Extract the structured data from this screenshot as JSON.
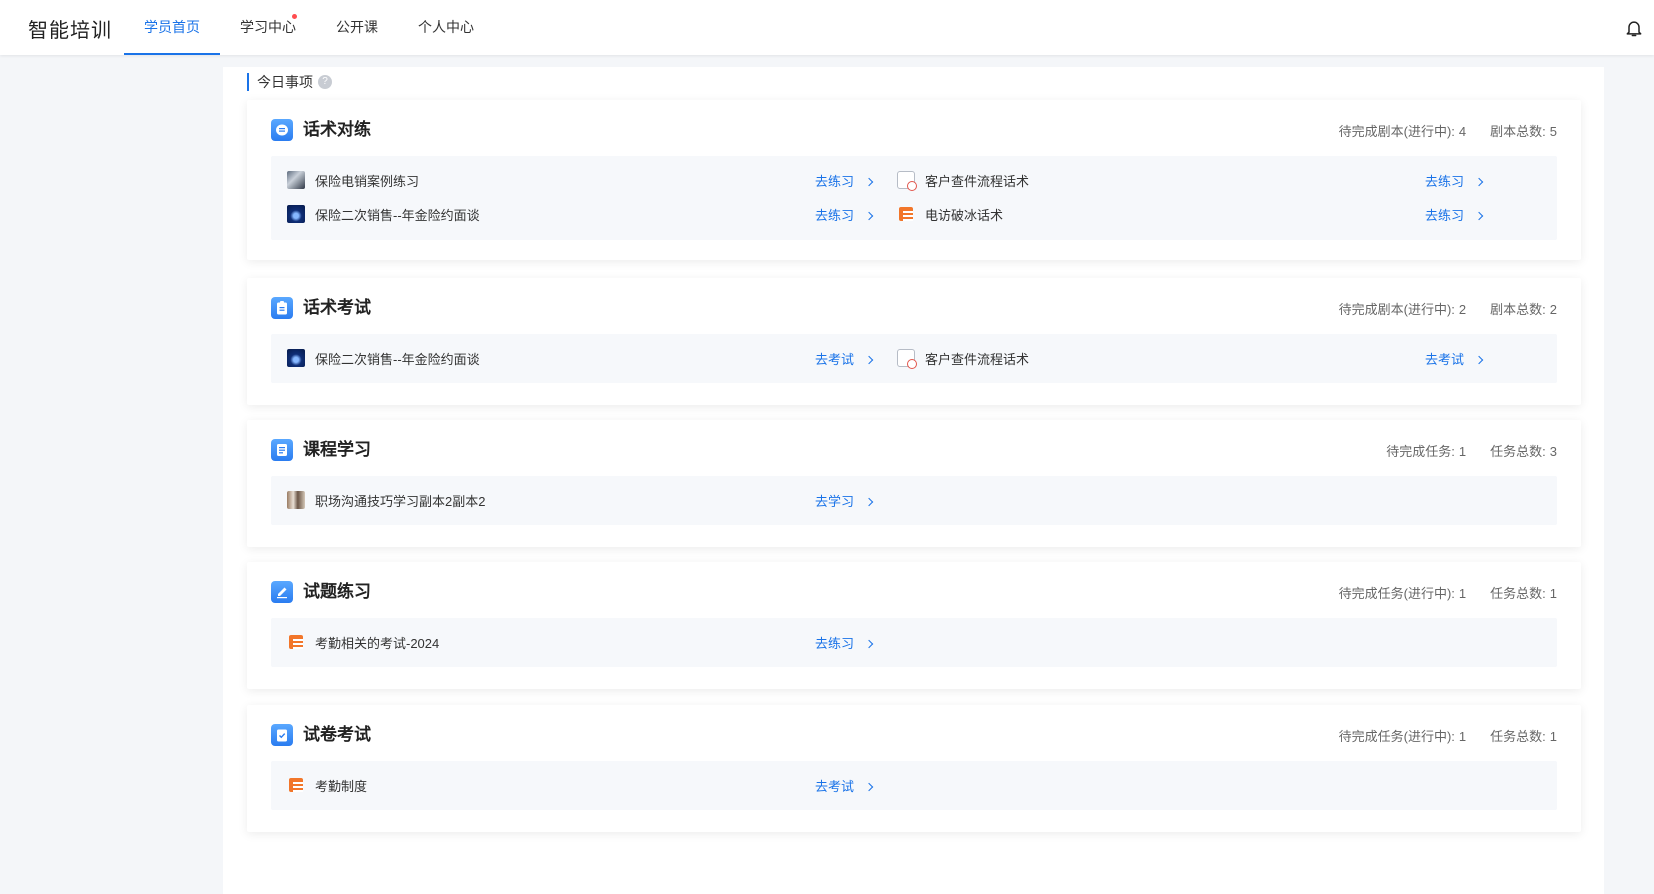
{
  "app": {
    "title": "智能培训"
  },
  "nav": {
    "tabs": [
      {
        "label": "学员首页",
        "active": true
      },
      {
        "label": "学习中心",
        "badge_dot": true
      },
      {
        "label": "公开课"
      },
      {
        "label": "个人中心"
      }
    ]
  },
  "today": {
    "title": "今日事项",
    "help_glyph": "?"
  },
  "sections": [
    {
      "title": "话术对练",
      "stats": [
        {
          "label": "待完成剧本(进行中):",
          "value": "4"
        },
        {
          "label": "剧本总数:",
          "value": "5"
        }
      ],
      "items": [
        {
          "name": "保险电销案例练习",
          "action": "去练习",
          "thumb": "photo"
        },
        {
          "name": "客户查件流程话术",
          "action": "去练习",
          "thumb": "calendar"
        },
        {
          "name": "保险二次销售--年金险约面谈",
          "action": "去练习",
          "thumb": "night"
        },
        {
          "name": "电访破冰话术",
          "action": "去练习",
          "thumb": "list"
        }
      ]
    },
    {
      "title": "话术考试",
      "stats": [
        {
          "label": "待完成剧本(进行中):",
          "value": "2"
        },
        {
          "label": "剧本总数:",
          "value": "2"
        }
      ],
      "items": [
        {
          "name": "保险二次销售--年金险约面谈",
          "action": "去考试",
          "thumb": "night"
        },
        {
          "name": "客户查件流程话术",
          "action": "去考试",
          "thumb": "calendar"
        }
      ]
    },
    {
      "title": "课程学习",
      "stats": [
        {
          "label": "待完成任务:",
          "value": "1"
        },
        {
          "label": "任务总数:",
          "value": "3"
        }
      ],
      "items": [
        {
          "name": "职场沟通技巧学习副本2副本2",
          "action": "去学习",
          "thumb": "crowd"
        }
      ]
    },
    {
      "title": "试题练习",
      "stats": [
        {
          "label": "待完成任务(进行中):",
          "value": "1"
        },
        {
          "label": "任务总数:",
          "value": "1"
        }
      ],
      "items": [
        {
          "name": "考勤相关的考试-2024",
          "action": "去练习",
          "thumb": "list"
        }
      ]
    },
    {
      "title": "试卷考试",
      "stats": [
        {
          "label": "待完成任务(进行中):",
          "value": "1"
        },
        {
          "label": "任务总数:",
          "value": "1"
        }
      ],
      "items": [
        {
          "name": "考勤制度",
          "action": "去考试",
          "thumb": "list"
        }
      ]
    }
  ],
  "colors": {
    "accent": "#1a73e8",
    "badge": "#ff4d4f",
    "orange_icon": "#f2762a"
  },
  "icons": {
    "header_right": "bell-icon"
  }
}
